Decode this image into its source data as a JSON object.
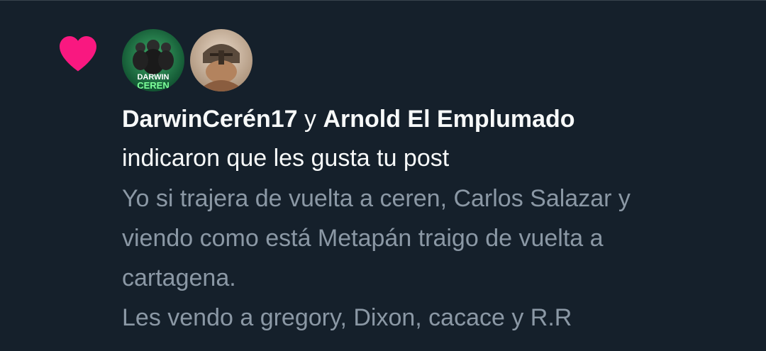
{
  "notification": {
    "type_icon": "heart-icon",
    "heart_color": "#f91880",
    "avatars": [
      {
        "label_line1": "DARWIN",
        "label_line2": "CEREN",
        "icon": "avatar-darwin"
      },
      {
        "icon": "avatar-arnold"
      }
    ],
    "user1": "DarwinCerén17",
    "conjunction": " y ",
    "user2": "Arnold El Emplumado",
    "action": "indicaron que les gusta tu post",
    "post_preview_lines": [
      "Yo si trajera de vuelta a ceren, Carlos Salazar y",
      "viendo como está Metapán traigo de vuelta a",
      "cartagena.",
      "Les vendo a gregory, Dixon, cacace y R.R"
    ]
  },
  "colors": {
    "background": "#15202b",
    "primary_text": "#f7f9f9",
    "secondary_text": "#8b98a5",
    "divider": "#38444d"
  }
}
